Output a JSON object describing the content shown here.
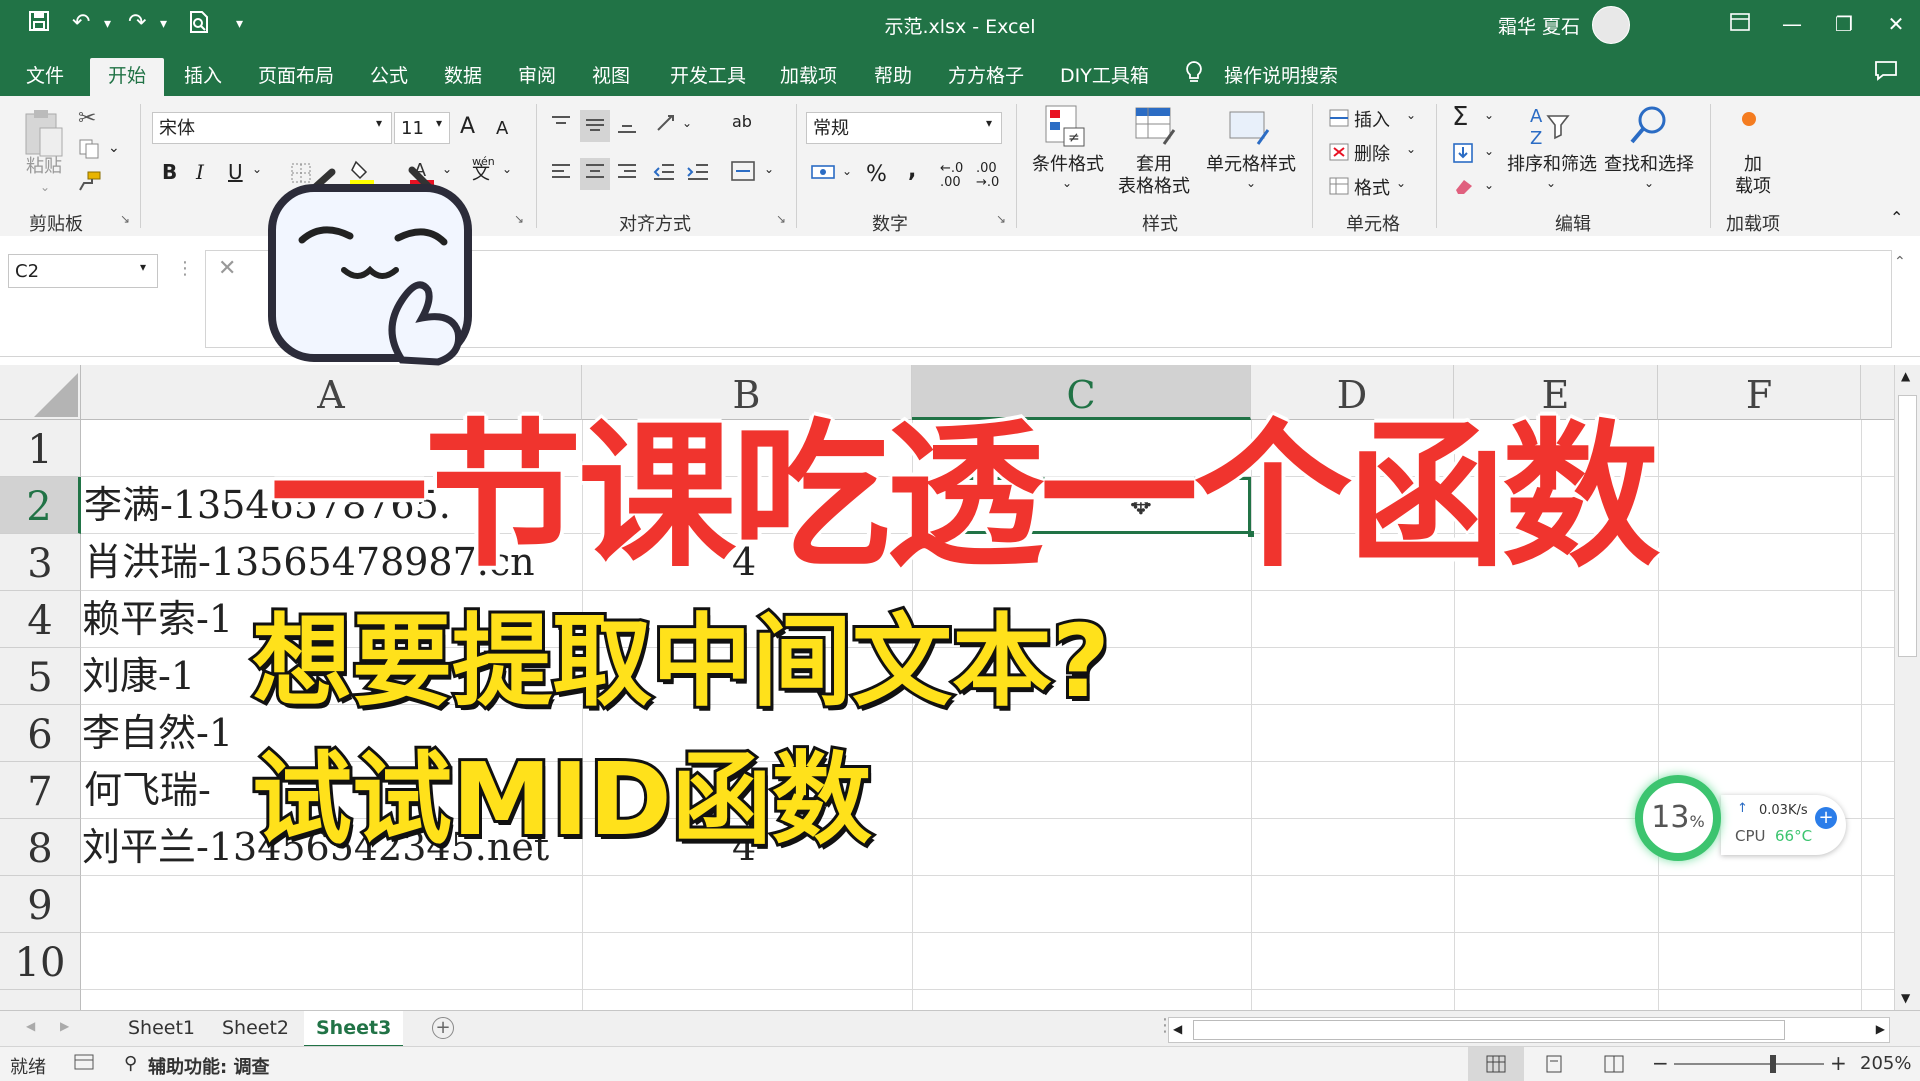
{
  "window": {
    "title": "示范.xlsx  -  Excel",
    "user": "霜华 夏石"
  },
  "tabs": [
    "文件",
    "开始",
    "插入",
    "页面布局",
    "公式",
    "数据",
    "审阅",
    "视图",
    "开发工具",
    "加载项",
    "帮助",
    "方方格子",
    "DIY工具箱"
  ],
  "active_tab": "开始",
  "tell_me": "操作说明搜索",
  "ribbon": {
    "clipboard": {
      "paste": "粘贴",
      "label": "剪贴板"
    },
    "font": {
      "name": "宋体",
      "size": "11",
      "bold": "B",
      "italic": "I",
      "underline": "U",
      "wen": "wén",
      "wen_char": "文",
      "grow": "A",
      "shrink": "A"
    },
    "alignment": {
      "label": "对齐方式",
      "wrap": "ab"
    },
    "number": {
      "format": "常规",
      "percent": "%",
      "comma": ",",
      "inc": ".00",
      "dec": "→.0",
      "label": "数字"
    },
    "styles": {
      "conditional": "条件格式",
      "table": "套用\n表格格式",
      "cell": "单元格样式",
      "label": "样式"
    },
    "cells": {
      "insert": "插入",
      "delete": "删除",
      "format": "格式",
      "label": "单元格"
    },
    "editing": {
      "sum": "Σ",
      "sort": "排序和筛选",
      "find": "查找和选择",
      "label": "编辑"
    },
    "addins": {
      "add": "加\n载项",
      "label": "加载项"
    }
  },
  "name_box": "C2",
  "columns": [
    "A",
    "B",
    "C",
    "D",
    "E",
    "F"
  ],
  "selected_column": "C",
  "rows": [
    "1",
    "2",
    "3",
    "4",
    "5",
    "6",
    "7",
    "8",
    "9",
    "10"
  ],
  "selected_row": "2",
  "cells": {
    "A2": " 李满-13546578765.",
    "A3": " 肖洪瑞-13565478987.cn",
    "A4": "赖平索-1",
    "A5": "  刘康-1",
    "A6": "李自然-1",
    "A7": " 何飞瑞-",
    "A8": "刘平兰-13456542345.net",
    "B3": "4",
    "B8": "4"
  },
  "sheets": [
    "Sheet1",
    "Sheet2",
    "Sheet3"
  ],
  "active_sheet": "Sheet3",
  "status": {
    "ready": "就绪",
    "accessibility": "辅助功能: 调查",
    "zoom": "205%"
  },
  "overlay": {
    "title": "一节课吃透一个函数",
    "subtitle1": "想要提取中间文本?",
    "subtitle2": "试试MID函数"
  },
  "widget": {
    "cpu_load": "13",
    "cpu_unit": "%",
    "net_speed": "0.03K/s",
    "cpu_label": "CPU",
    "cpu_temp": "66°C"
  },
  "colors": {
    "excel_green": "#217346",
    "title_red": "#f0342e",
    "subtitle_yellow": "#ffe11b"
  }
}
